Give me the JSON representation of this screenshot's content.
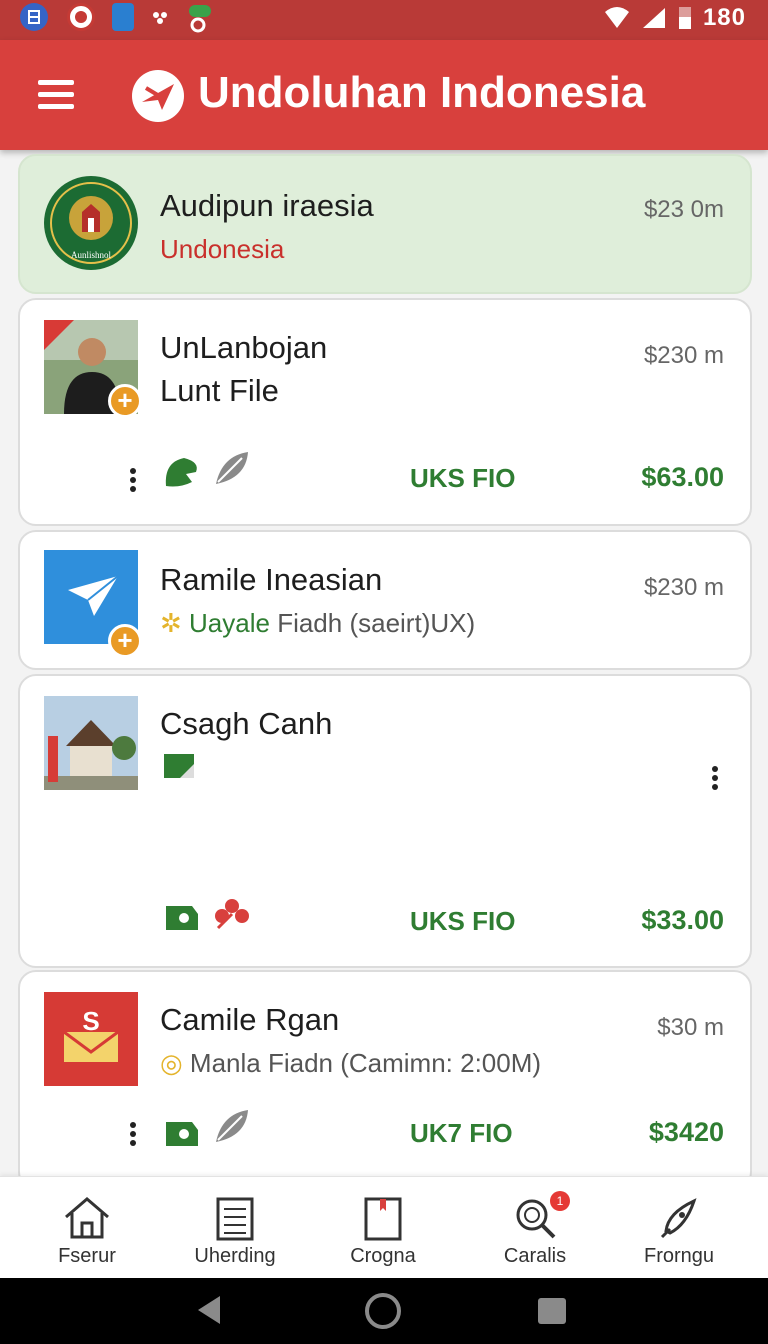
{
  "status_bar": {
    "time": "180"
  },
  "app_bar": {
    "title": "Undoluhan Indonesia",
    "menu_icon": "hamburger-icon",
    "logo_icon": "plane-logo-icon"
  },
  "items": [
    {
      "title": "Audipun iraesia",
      "subtitle": "Undonesia",
      "size": "$23 0m",
      "thumb": "emblem"
    },
    {
      "title_line1": "UnLanbojan",
      "title_line2": "Lunt File",
      "size": "$230 m",
      "code": "UKS FIO",
      "price": "$63.00",
      "thumb": "person"
    },
    {
      "title": "Ramile Ineasian",
      "subtitle_highlight": "Uayale",
      "subtitle_rest": " Fiadh (saeirt)UX)",
      "size": "$230 m",
      "thumb": "paper-plane"
    },
    {
      "title": "Csagh Canh",
      "code": "UKS FIO",
      "price": "$33.00",
      "thumb": "building"
    },
    {
      "title": "Camile Rgan",
      "subtitle": "Manla Fiadn (Camimn: 2:00M)",
      "size": "$30 m",
      "code": "UK7 FIO",
      "price": "$3420",
      "thumb": "mail-badge"
    }
  ],
  "bottom_nav": [
    {
      "label": "Fserur",
      "icon": "home-icon"
    },
    {
      "label": "Uherding",
      "icon": "document-icon"
    },
    {
      "label": "Crogna",
      "icon": "bookmark-icon"
    },
    {
      "label": "Caralis",
      "icon": "search-icon",
      "badge": "1"
    },
    {
      "label": "Frorngu",
      "icon": "rocket-icon"
    }
  ],
  "colors": {
    "primary": "#d8403d",
    "status_bar": "#b93a37",
    "green": "#2f7d32",
    "highlight_bg": "#dfeeda",
    "badge": "#e99a25"
  }
}
